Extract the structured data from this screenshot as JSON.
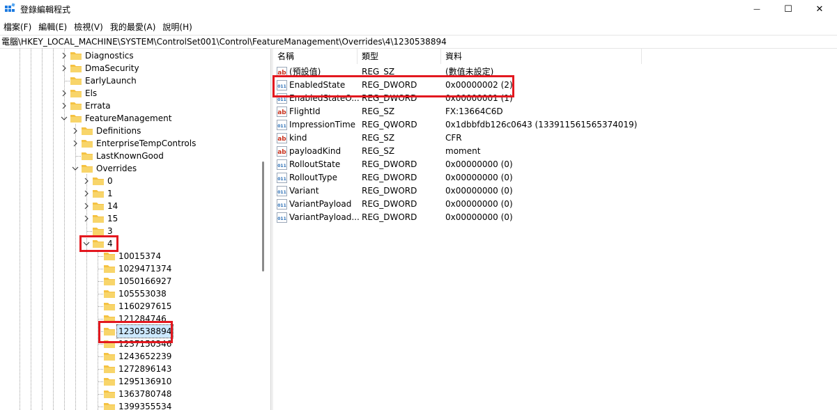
{
  "window": {
    "title": "登錄編輯程式",
    "minimize_glyph": "—",
    "maximize_glyph": "☐",
    "close_glyph": "✕"
  },
  "menu": [
    "檔案(F)",
    "編輯(E)",
    "檢視(V)",
    "我的最愛(A)",
    "說明(H)"
  ],
  "address": "電腦\\HKEY_LOCAL_MACHINE\\SYSTEM\\ControlSet001\\Control\\FeatureManagement\\Overrides\\4\\1230538894",
  "tree": [
    {
      "label": "Diagnostics",
      "expander": "collapsed"
    },
    {
      "label": "DmaSecurity",
      "expander": "collapsed"
    },
    {
      "label": "EarlyLaunch",
      "expander": "none"
    },
    {
      "label": "Els",
      "expander": "collapsed"
    },
    {
      "label": "Errata",
      "expander": "collapsed"
    },
    {
      "label": "FeatureManagement",
      "expander": "expanded"
    },
    {
      "label": "Definitions",
      "expander": "collapsed"
    },
    {
      "label": "EnterpriseTempControls",
      "expander": "collapsed"
    },
    {
      "label": "LastKnownGood",
      "expander": "none"
    },
    {
      "label": "Overrides",
      "expander": "expanded"
    },
    {
      "label": "0",
      "expander": "collapsed"
    },
    {
      "label": "1",
      "expander": "collapsed"
    },
    {
      "label": "14",
      "expander": "collapsed"
    },
    {
      "label": "15",
      "expander": "collapsed"
    },
    {
      "label": "3",
      "expander": "none"
    },
    {
      "label": "4",
      "expander": "expanded"
    },
    {
      "label": "10015374",
      "expander": "none"
    },
    {
      "label": "1029471374",
      "expander": "none"
    },
    {
      "label": "1050166927",
      "expander": "none"
    },
    {
      "label": "105553038",
      "expander": "none"
    },
    {
      "label": "1160297615",
      "expander": "none"
    },
    {
      "label": "121284746",
      "expander": "none"
    },
    {
      "label": "1230538894",
      "expander": "none",
      "selected": true
    },
    {
      "label": "1237150346",
      "expander": "none"
    },
    {
      "label": "1243652239",
      "expander": "none"
    },
    {
      "label": "1272896143",
      "expander": "none"
    },
    {
      "label": "1295136910",
      "expander": "none"
    },
    {
      "label": "1363780748",
      "expander": "none"
    },
    {
      "label": "1399355534",
      "expander": "none"
    }
  ],
  "columns": [
    "名稱",
    "類型",
    "資料"
  ],
  "values": [
    {
      "icon": "string-value-icon",
      "name": "(預設值)",
      "type": "REG_SZ",
      "data": "(數值未設定)"
    },
    {
      "icon": "binary-value-icon",
      "name": "EnabledState",
      "type": "REG_DWORD",
      "data": "0x00000002 (2)"
    },
    {
      "icon": "binary-value-icon",
      "name": "EnabledStateO...",
      "type": "REG_DWORD",
      "data": "0x00000001 (1)"
    },
    {
      "icon": "string-value-icon",
      "name": "FlightId",
      "type": "REG_SZ",
      "data": "FX:13664C6D"
    },
    {
      "icon": "binary-value-icon",
      "name": "ImpressionTime",
      "type": "REG_QWORD",
      "data": "0x1dbbfdb126c0643 (133911561565374019)"
    },
    {
      "icon": "string-value-icon",
      "name": "kind",
      "type": "REG_SZ",
      "data": "CFR"
    },
    {
      "icon": "string-value-icon",
      "name": "payloadKind",
      "type": "REG_SZ",
      "data": "moment"
    },
    {
      "icon": "binary-value-icon",
      "name": "RolloutState",
      "type": "REG_DWORD",
      "data": "0x00000000 (0)"
    },
    {
      "icon": "binary-value-icon",
      "name": "RolloutType",
      "type": "REG_DWORD",
      "data": "0x00000000 (0)"
    },
    {
      "icon": "binary-value-icon",
      "name": "Variant",
      "type": "REG_DWORD",
      "data": "0x00000000 (0)"
    },
    {
      "icon": "binary-value-icon",
      "name": "VariantPayload",
      "type": "REG_DWORD",
      "data": "0x00000000 (0)"
    },
    {
      "icon": "binary-value-icon",
      "name": "VariantPayload...",
      "type": "REG_DWORD",
      "data": "0x00000000 (0)"
    }
  ],
  "colors": {
    "highlight": "#e3181f",
    "folder": "#f5c242",
    "selection": "#cce8ff",
    "string_icon": "#c8321e",
    "binary_icon": "#2a6eb5"
  }
}
